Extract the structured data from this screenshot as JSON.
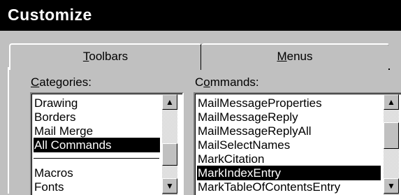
{
  "window": {
    "title": "Customize"
  },
  "tabs": [
    {
      "label_pre": "",
      "label_key": "T",
      "label_post": "oolbars"
    },
    {
      "label_pre": "",
      "label_key": "M",
      "label_post": "enus"
    }
  ],
  "categories": {
    "label_key": "C",
    "label_post": "ategories:",
    "items": [
      "Drawing",
      "Borders",
      "Mail Merge",
      "All Commands",
      "",
      "Macros",
      "Fonts"
    ],
    "selected_index": 3
  },
  "commands": {
    "label_pre": "C",
    "label_key": "o",
    "label_post": "mmands:",
    "items": [
      "MailMessageProperties",
      "MailMessageReply",
      "MailMessageReplyAll",
      "MailSelectNames",
      "MarkCitation",
      "MarkIndexEntry",
      "MarkTableOfContentsEntry"
    ],
    "selected_index": 5
  },
  "icons": {
    "scroll_up": "arrow-up-icon",
    "scroll_down": "arrow-down-icon"
  }
}
